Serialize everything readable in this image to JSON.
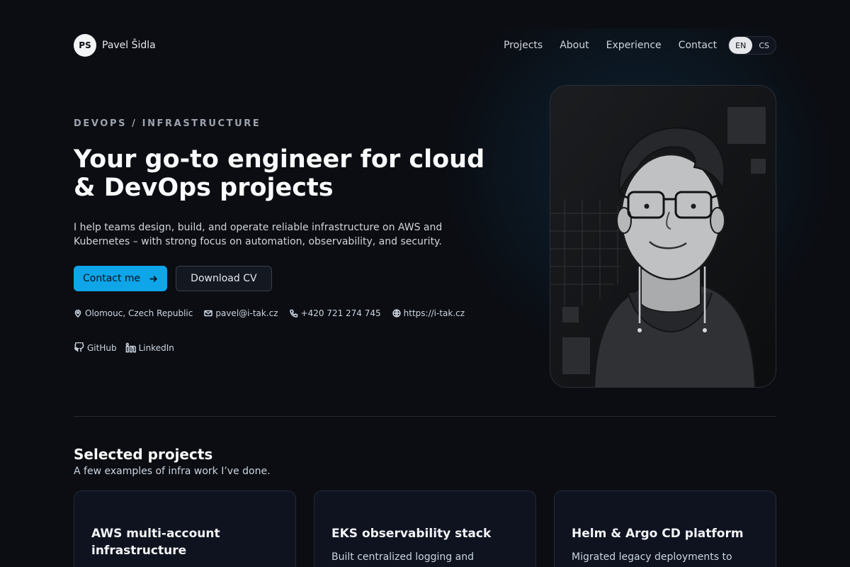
{
  "header": {
    "logo_initials": "PS",
    "name": "Pavel Šidla",
    "nav": [
      "Projects",
      "About",
      "Experience",
      "Contact"
    ],
    "lang": {
      "en": "EN",
      "cs": "CS",
      "active": "EN"
    }
  },
  "hero": {
    "eyebrow": "DEVOPS / INFRASTRUCTURE",
    "title": "Your go-to engineer for cloud & DevOps projects",
    "lead": "I help teams design, build, and operate reliable infrastructure on AWS and Kubernetes – with strong focus on automation, observability, and security.",
    "primary_cta": "Contact me",
    "secondary_cta": "Download CV",
    "location": "Olomouc, Czech Republic",
    "email": "pavel@i-tak.cz",
    "phone": "+420 721 274 745",
    "website": "https://i-tak.cz",
    "github": "GitHub",
    "linkedin": "LinkedIn"
  },
  "projects": {
    "title": "Selected projects",
    "subtitle": "A few examples of infra work I’ve done.",
    "cards": [
      {
        "title": "AWS multi-account infrastructure",
        "desc": ""
      },
      {
        "title": "EKS observability stack",
        "desc": "Built centralized logging and"
      },
      {
        "title": "Helm & Argo CD platform",
        "desc": "Migrated legacy deployments to"
      }
    ]
  },
  "colors": {
    "accent": "#0ea5e9",
    "background": "#0b0d12",
    "card": "#0f1320"
  },
  "icons": [
    "map-pin-icon",
    "mail-icon",
    "phone-icon",
    "globe-icon",
    "github-icon",
    "linkedin-icon",
    "arrow-right-icon"
  ]
}
